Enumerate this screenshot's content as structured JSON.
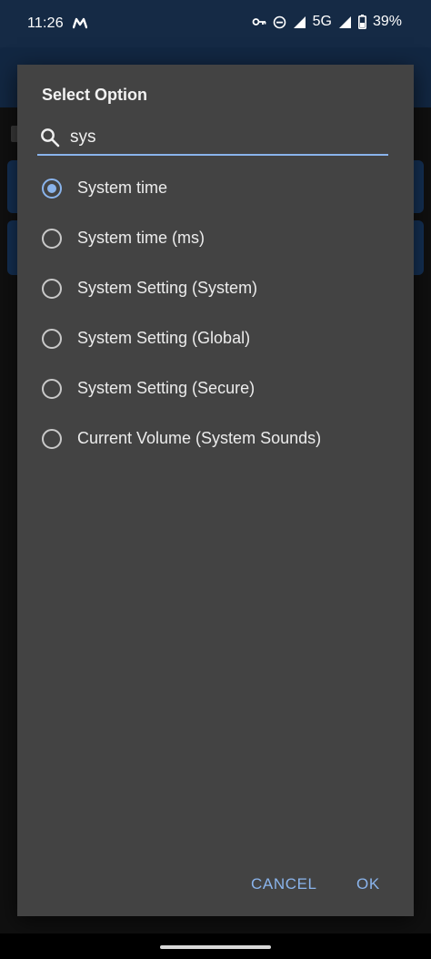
{
  "status_bar": {
    "time": "11:26",
    "network": "5G",
    "battery": "39%",
    "icons": [
      "notification-m-icon",
      "vpn-key-icon",
      "do-not-disturb-icon",
      "wifi-signal-icon",
      "cell-signal-icon",
      "battery-icon"
    ]
  },
  "dialog": {
    "title": "Select Option",
    "search": {
      "value": "sys",
      "icon": "search-icon"
    },
    "options": [
      {
        "label": "System time",
        "selected": true
      },
      {
        "label": "System time (ms)",
        "selected": false
      },
      {
        "label": "System Setting (System)",
        "selected": false
      },
      {
        "label": "System Setting (Global)",
        "selected": false
      },
      {
        "label": "System Setting (Secure)",
        "selected": false
      },
      {
        "label": "Current Volume (System Sounds)",
        "selected": false
      }
    ],
    "buttons": {
      "cancel": "CANCEL",
      "ok": "OK"
    },
    "accent_color": "#8ab4ec"
  },
  "colors": {
    "status_bar": "#152a45",
    "app_toolbar": "#1c3d66",
    "dialog_background": "#434343",
    "card": "#1f4b82"
  }
}
